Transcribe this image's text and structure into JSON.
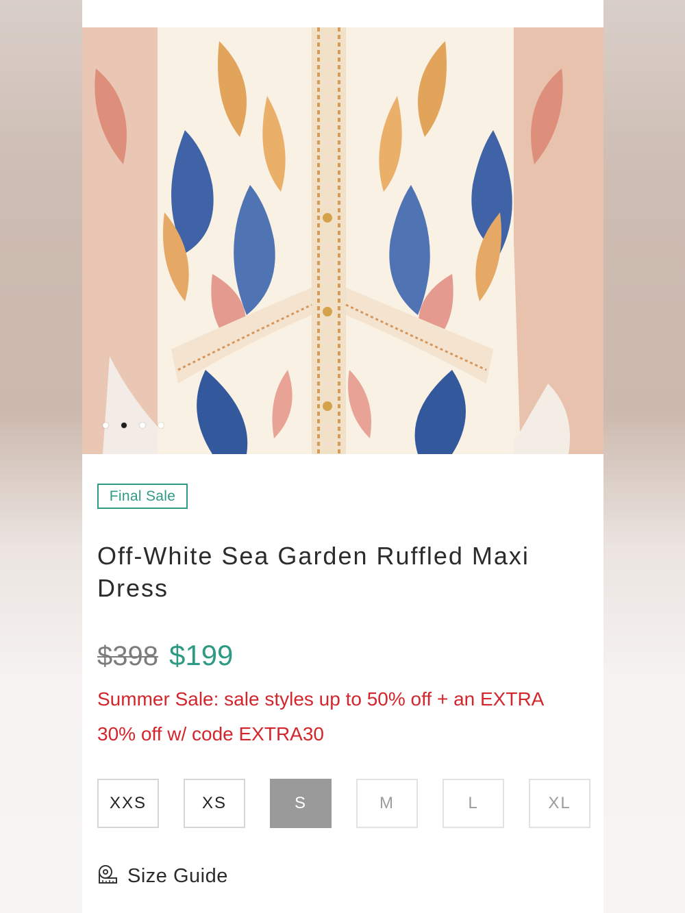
{
  "gallery": {
    "image_alt": "Off-White Sea Garden Ruffled Maxi Dress",
    "dots": [
      false,
      true,
      false,
      false
    ]
  },
  "product": {
    "badge": "Final Sale",
    "title": "Off-White Sea Garden Ruffled Maxi Dress",
    "original_price": "$398",
    "sale_price": "$199",
    "promo_text": "Summer Sale: sale styles up to 50% off + an EXTRA 30% off w/ code EXTRA30"
  },
  "sizes": [
    {
      "label": "XXS",
      "state": "available"
    },
    {
      "label": "XS",
      "state": "available"
    },
    {
      "label": "S",
      "state": "selected"
    },
    {
      "label": "M",
      "state": "unavailable"
    },
    {
      "label": "L",
      "state": "unavailable"
    },
    {
      "label": "XL",
      "state": "unavailable"
    }
  ],
  "size_guide": {
    "label": "Size Guide",
    "icon": "measuring-tape-icon"
  },
  "colors": {
    "accent": "#2f9a84",
    "promo": "#d3262c",
    "selected_size": "#9a9a9a"
  }
}
